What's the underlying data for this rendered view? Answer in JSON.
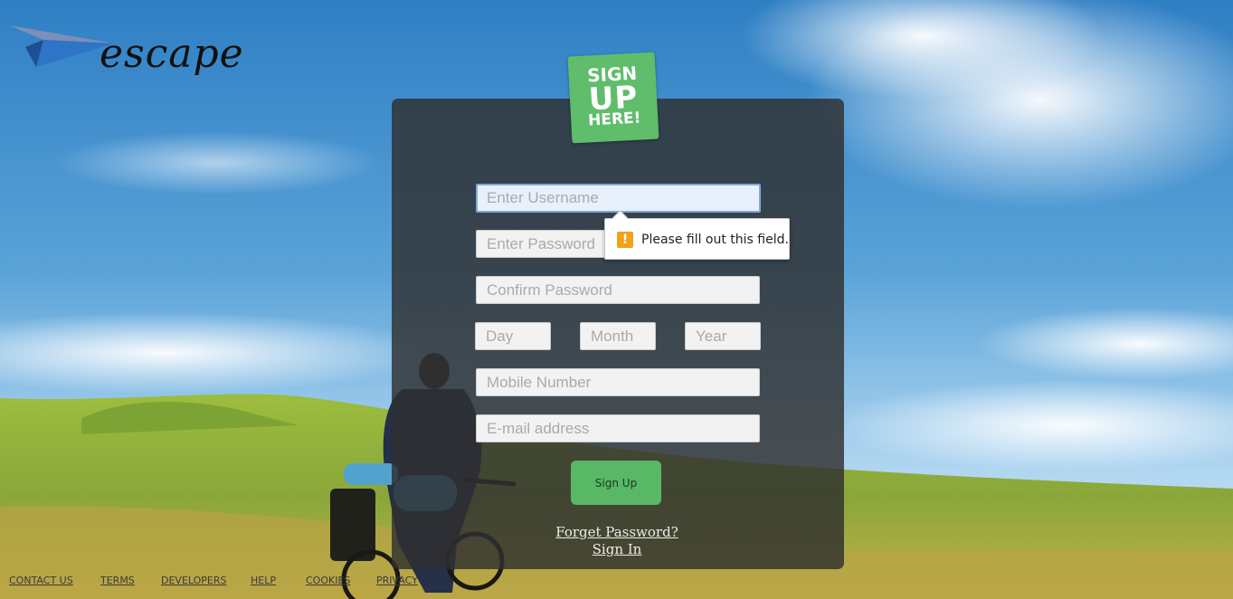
{
  "brand": {
    "name": "escape"
  },
  "badge": {
    "line1": "SIGN",
    "line2": "UP",
    "line3": "HERE!"
  },
  "form": {
    "username_placeholder": "Enter Username",
    "password_placeholder": "Enter Password",
    "confirm_placeholder": "Confirm Password",
    "day_placeholder": "Day",
    "month_placeholder": "Month",
    "year_placeholder": "Year",
    "mobile_placeholder": "Mobile Number",
    "email_placeholder": "E-mail address",
    "submit_label": "Sign Up"
  },
  "links": {
    "forgot": "Forget Password?",
    "signin": "Sign In"
  },
  "validation": {
    "message": "Please fill out this field.",
    "icon": "warning-icon"
  },
  "footer": {
    "items": [
      "CONTACT US",
      "TERMS",
      "DEVELOPERS",
      "HELP",
      "COOKIES",
      "PRIVACY"
    ]
  },
  "colors": {
    "accent_green": "#58b865",
    "panel": "#303030",
    "warning": "#f0a21a"
  }
}
